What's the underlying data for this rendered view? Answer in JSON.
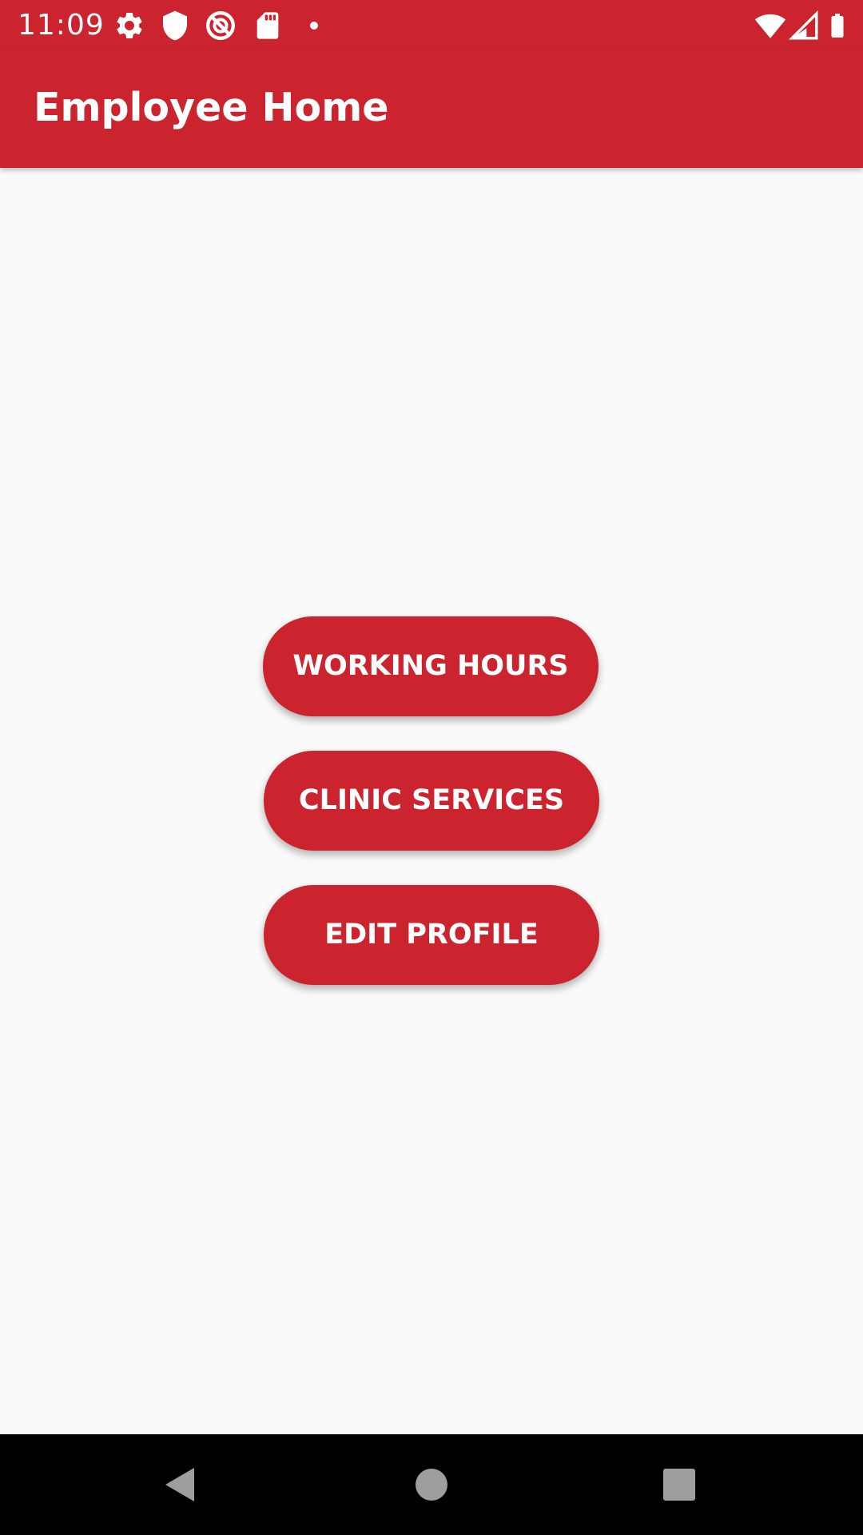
{
  "status_bar": {
    "time": "11:09",
    "left_icons": [
      "gear-icon",
      "shield-icon",
      "blocked-signal-icon",
      "sd-card-icon",
      "dot-icon"
    ],
    "right_icons": [
      "wifi-icon",
      "cell-signal-icon",
      "battery-icon"
    ]
  },
  "app_bar": {
    "title": "Employee Home"
  },
  "main": {
    "buttons": [
      {
        "label": "WORKING HOURS"
      },
      {
        "label": "CLINIC SERVICES"
      },
      {
        "label": "EDIT PROFILE"
      }
    ]
  },
  "nav_bar": {
    "items": [
      "back-icon",
      "home-icon",
      "recents-icon"
    ]
  },
  "colors": {
    "primary": "#cc242e",
    "background": "#fafafa",
    "on_primary": "#ffffff",
    "nav_bar": "#000000",
    "nav_icons": "#9e9e9e"
  }
}
